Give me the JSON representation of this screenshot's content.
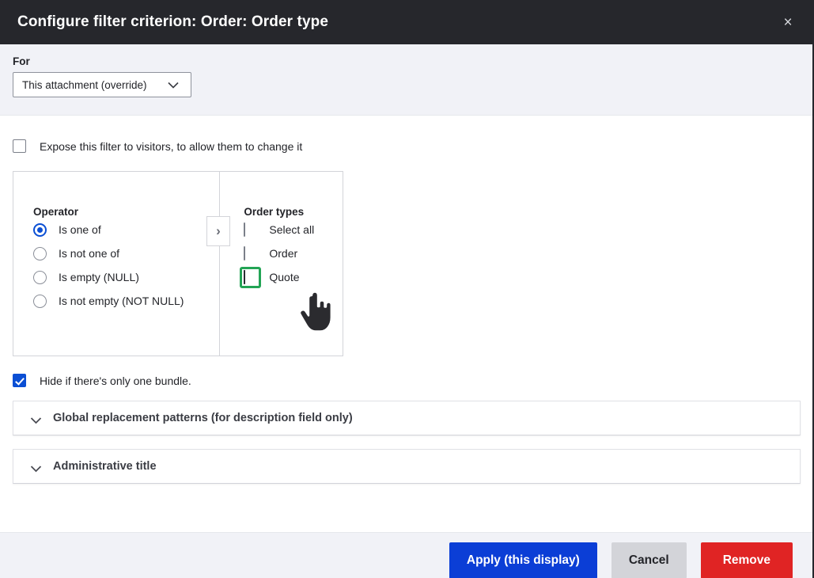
{
  "header": {
    "title": "Configure filter criterion: Order: Order type",
    "close_label": "×"
  },
  "for_section": {
    "label": "For",
    "select_value": "This attachment (override)"
  },
  "expose": {
    "label": "Expose this filter to visitors, to allow them to change it",
    "checked": false
  },
  "operator_panel": {
    "heading": "Operator",
    "options": [
      {
        "label": "Is one of",
        "selected": true
      },
      {
        "label": "Is not one of",
        "selected": false
      },
      {
        "label": "Is empty (NULL)",
        "selected": false
      },
      {
        "label": "Is not empty (NOT NULL)",
        "selected": false
      }
    ],
    "arrow_label": "›"
  },
  "values_panel": {
    "heading": "Order types",
    "options": [
      {
        "label": "Select all",
        "checked": false,
        "highlighted": false
      },
      {
        "label": "Order",
        "checked": false,
        "highlighted": false
      },
      {
        "label": "Quote",
        "checked": true,
        "highlighted": true
      }
    ]
  },
  "hide_bundle": {
    "label": "Hide if there's only one bundle.",
    "checked": true
  },
  "details_sections": [
    {
      "title": "Global replacement patterns (for description field only)"
    },
    {
      "title": "Administrative title"
    }
  ],
  "footer": {
    "apply_label": "Apply (this display)",
    "cancel_label": "Cancel",
    "remove_label": "Remove"
  },
  "colors": {
    "header_bg": "#26272c",
    "band_bg": "#f1f2f7",
    "accent_blue": "#0b4fd4",
    "primary_button": "#0b3ed6",
    "danger_button": "#e02424",
    "secondary_button": "#d3d4d9",
    "highlight_green": "#23a455"
  }
}
